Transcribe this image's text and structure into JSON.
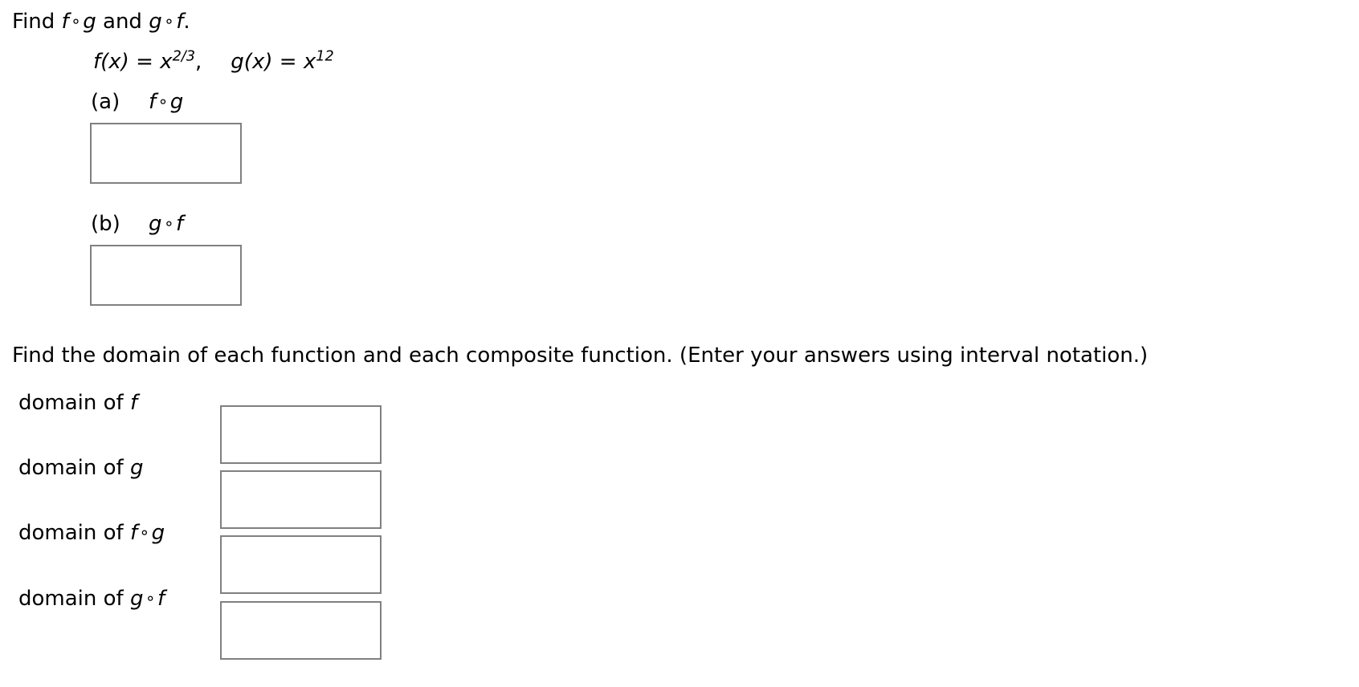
{
  "problem": {
    "heading_prefix": "Find ",
    "heading_fog": "f ∘ g",
    "heading_mid": " and ",
    "heading_gof": "g ∘ f",
    "heading_suffix": ".",
    "heading_full": "Find f ∘ g and g ∘ f.",
    "definitions": {
      "f_name": "f",
      "f_arg": "(x)",
      "f_equals": "=",
      "f_base": "x",
      "f_exponent": "2/3",
      "separator": ",",
      "g_name": "g",
      "g_arg": "(x)",
      "g_equals": "=",
      "g_base": "x",
      "g_exponent": "12",
      "full_text": "f(x) = x^(2/3),   g(x) = x^12"
    },
    "parts": [
      {
        "tag": "(a)",
        "expression_left": "f",
        "expression_op": "∘",
        "expression_right": "g",
        "expression": "f ∘ g",
        "answer_value": "",
        "answer_placeholder": ""
      },
      {
        "tag": "(b)",
        "expression_left": "g",
        "expression_op": "∘",
        "expression_right": "f",
        "expression": "g ∘ f",
        "answer_value": "",
        "answer_placeholder": ""
      }
    ]
  },
  "domain_section": {
    "instruction": "Find the domain of each function and each composite function. (Enter your answers using interval notation.)",
    "rows": [
      {
        "label_prefix": "domain of ",
        "expression": "f",
        "label_full": "domain of f",
        "answer_value": "",
        "answer_placeholder": ""
      },
      {
        "label_prefix": "domain of ",
        "expression": "g",
        "label_full": "domain of g",
        "answer_value": "",
        "answer_placeholder": ""
      },
      {
        "label_prefix": "domain of ",
        "expression": "f ∘ g",
        "label_full": "domain of f ∘ g",
        "answer_value": "",
        "answer_placeholder": ""
      },
      {
        "label_prefix": "domain of ",
        "expression": "g ∘ f",
        "label_full": "domain of g ∘ f",
        "answer_value": "",
        "answer_placeholder": ""
      }
    ]
  },
  "style": {
    "background": "#ffffff",
    "text_color": "#000000",
    "input_border_color": "#808080"
  }
}
